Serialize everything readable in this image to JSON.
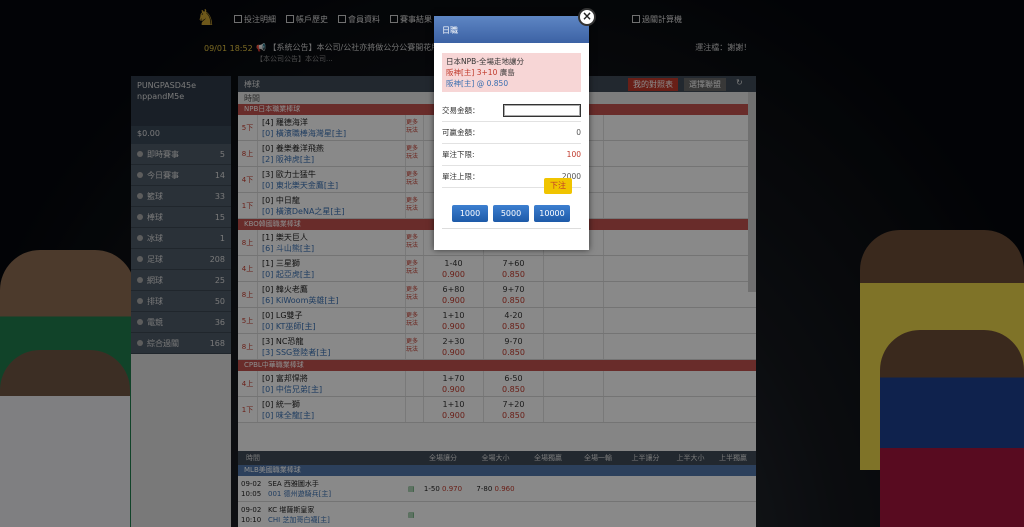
{
  "topbar": {
    "nav": [
      "投注明細",
      "帳戶歷史",
      "會員資料",
      "賽事結果",
      "過關計算機"
    ],
    "time": "09/01 18:52",
    "notice": "【系統公告】本公司/公社亦將做公分公賽開花所各分",
    "notice2": "【本公司公告】本公司...",
    "notice_right": "運注檔：謝謝！"
  },
  "sidebar": {
    "user_line1": "PUNGPASD45e",
    "user_line2": "nppandM5e",
    "balance": "$0.00",
    "items": [
      {
        "label": "即時賽事",
        "count": "5"
      },
      {
        "label": "今日賽事",
        "count": "14"
      },
      {
        "label": "籃球",
        "count": "33"
      },
      {
        "label": "棒球",
        "count": "15"
      },
      {
        "label": "冰球",
        "count": "1"
      },
      {
        "label": "足球",
        "count": "208"
      },
      {
        "label": "網球",
        "count": "25"
      },
      {
        "label": "排球",
        "count": "50"
      },
      {
        "label": "電競",
        "count": "36"
      },
      {
        "label": "綜合過關",
        "count": "168"
      }
    ]
  },
  "main": {
    "header_title": "棒球",
    "btn_red": "我的對照表",
    "btn_gray": "選擇聯盟",
    "col_league": "時間",
    "leagues": [
      {
        "name": "NPB日本職業棒球",
        "matches": [
          {
            "time": "5下",
            "t1": "[4] 羅德海洋",
            "t2": "[0] 橫濱職棒海灣星[主]",
            "note": "更多玩法",
            "h1": "",
            "o1": "",
            "h2": "",
            "o2": "",
            "o3": ""
          },
          {
            "time": "8上",
            "t1": "[0] 養樂養洋飛燕",
            "t2": "[2] 阪神虎[主]",
            "note": "更多玩法",
            "h1": "",
            "o1": "",
            "h2": "",
            "o2": "",
            "o3": ""
          },
          {
            "time": "4下",
            "t1": "[3] 歐力士猛牛",
            "t2": "[0] 東北樂天金鷹[主]",
            "note": "更多玩法",
            "h1": "",
            "o1": "",
            "h2": "",
            "o2": "",
            "o3": ""
          },
          {
            "time": "1下",
            "t1": "[0] 中日龍",
            "t2": "[0] 橫濱DeNA之星[主]",
            "note": "更多玩法",
            "h1": "",
            "o1": "",
            "h2": "",
            "o2": "",
            "o3": ""
          }
        ]
      },
      {
        "name": "KBO韓國職業棒球",
        "matches": [
          {
            "time": "8上",
            "t1": "[1] 樂天巨人",
            "t2": "[6] 斗山熊[主]",
            "note": "更多玩法",
            "h1": "",
            "o1": "",
            "h2": "",
            "o2": "",
            "o3": ""
          },
          {
            "time": "4上",
            "t1": "[1] 三星獅",
            "t2": "[0] 起亞虎[主]",
            "note": "更多玩法",
            "h1": "1-40",
            "o1": "0.900",
            "h2": "7+60",
            "o2": "0.850",
            "o3": ""
          },
          {
            "time": "8上",
            "t1": "[0] 韓火老鷹",
            "t2": "[6] KiWoom英雄[主]",
            "note": "更多玩法",
            "h1": "6+80",
            "o1": "0.900",
            "h2": "9+70",
            "o2": "0.850",
            "o3": ""
          },
          {
            "time": "5上",
            "t1": "[0] LG雙子",
            "t2": "[0] KT巫師[主]",
            "note": "更多玩法",
            "h1": "1+10",
            "o1": "0.900",
            "h2": "4-20",
            "o2": "0.850",
            "o3": ""
          },
          {
            "time": "8上",
            "t1": "[3] NC恐龍",
            "t2": "[3] SSG登陸者[主]",
            "note": "更多玩法",
            "h1": "2+30",
            "o1": "0.900",
            "h2": "9-70",
            "o2": "0.850",
            "o3": ""
          }
        ]
      },
      {
        "name": "CPBL中華職業棒球",
        "matches": [
          {
            "time": "4上",
            "t1": "[0] 富邦悍將",
            "t2": "[0] 中信兄弟[主]",
            "note": "",
            "h1": "1+70",
            "o1": "0.900",
            "h2": "6-50",
            "o2": "0.850",
            "o3": ""
          },
          {
            "time": "1下",
            "t1": "[0] 統一獅",
            "t2": "[0] 味全龍[主]",
            "note": "",
            "h1": "1+10",
            "o1": "0.900",
            "h2": "7+20",
            "o2": "0.850",
            "o3": ""
          }
        ]
      }
    ],
    "bottom_head": [
      "時間",
      "全場讓分",
      "全場大小",
      "全場獨贏",
      "全場一輸",
      "上半讓分",
      "上半大小",
      "上半獨贏"
    ],
    "bottom_league": "MLB美國職業棒球",
    "bottom_rows": [
      {
        "date": "09-02",
        "time": "10:05",
        "t1": "SEA",
        "t1n": "西雅圖水手",
        "t2": "001",
        "t2n": "德州遊騎兵[主]",
        "pitch1": "",
        "h": "1-50",
        "o": "0.970",
        "tot": "7-80",
        "to": "0.960"
      },
      {
        "date": "09-02",
        "time": "10:10",
        "t1": "KC",
        "t1n": "堪薩斯皇家",
        "t2": "CHI",
        "t2n": "芝加哥白襪[主]",
        "pitch1": "",
        "h": "",
        "o": "",
        "tot": "",
        "to": ""
      }
    ]
  },
  "modal": {
    "title": "日職",
    "close": "×",
    "info_line1": "日本NPB-全場走地讓分",
    "info_line2_a": "阪神[主]",
    "info_line2_b": "3+10",
    "info_line2_c": "廣島",
    "info_line3_a": "阪神[主]",
    "info_line3_b": "@ 0.850",
    "amount_label": "交易金額：",
    "amount_placeholder": "",
    "win_label": "可贏金額：",
    "win_value": "0",
    "min_label": "單注下限:",
    "min_value": "100",
    "max_label": "單注上限：",
    "max_value": "2000",
    "bet_label": "下注",
    "quick": [
      "1000",
      "5000",
      "10000"
    ]
  }
}
